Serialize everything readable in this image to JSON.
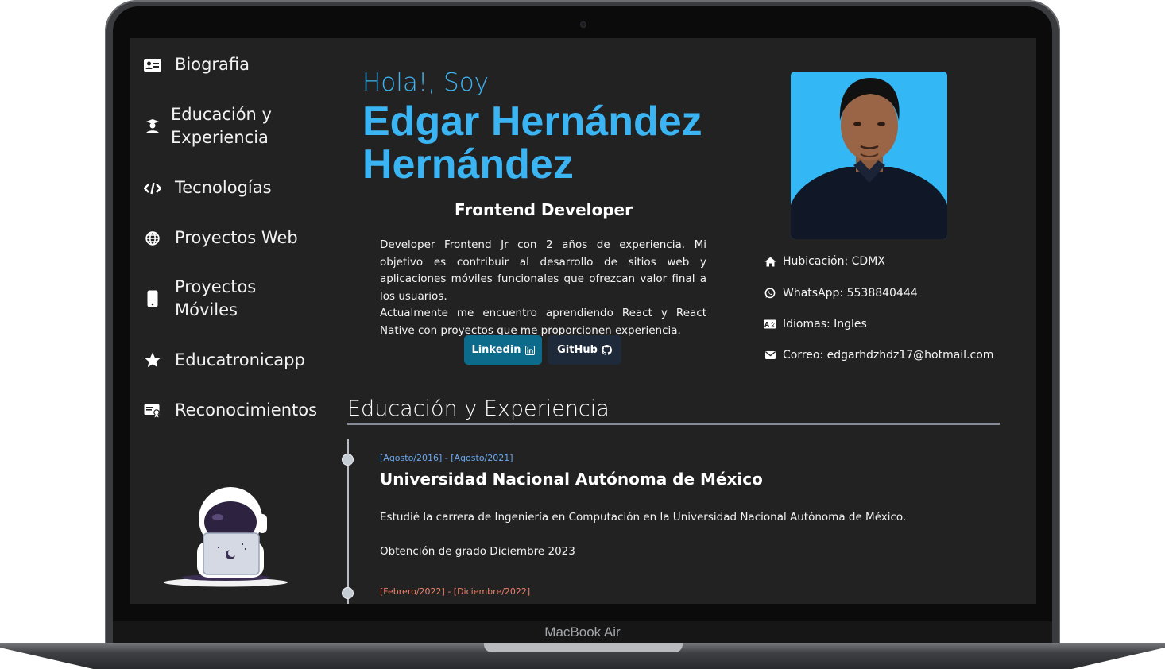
{
  "device": {
    "brand_label": "MacBook Air"
  },
  "sidebar": {
    "items": [
      {
        "label": "Biografia",
        "icon": "id-card-icon"
      },
      {
        "label": "Educación y Experiencia",
        "icon": "graduate-icon"
      },
      {
        "label": "Tecnologías",
        "icon": "code-icon"
      },
      {
        "label": "Proyectos Web",
        "icon": "globe-icon"
      },
      {
        "label": "Proyectos Móviles",
        "icon": "smartphone-icon"
      },
      {
        "label": "Educatronicapp",
        "icon": "star-icon"
      },
      {
        "label": "Reconocimientos",
        "icon": "certificate-icon"
      }
    ]
  },
  "hero": {
    "greeting": "Hola!, Soy",
    "name_line1": "Edgar Hernández",
    "name_line2": "Hernández",
    "role": "Frontend Developer",
    "bio_p1": "Developer Frontend Jr con 2 años de experiencia. Mi objetivo es contribuir al desarrollo de sitios web y aplicaciones móviles funcionales que ofrezcan valor final a los usuarios.",
    "bio_p2": "Actualmente me encuentro aprendiendo React y React Native con proyectos que me proporcionen experiencia.",
    "buttons": {
      "linkedin": "Linkedin",
      "github": "GitHub"
    }
  },
  "contact": {
    "location": "Hubicación: CDMX",
    "whatsapp": "WhatsApp: 5538840444",
    "languages": "Idiomas: Ingles",
    "email": "Correo: edgarhdzhdz17@hotmail.com"
  },
  "education": {
    "title": "Educación y Experiencia",
    "entries": [
      {
        "date": "[Agosto/2016] - [Agosto/2021]",
        "date_color": "#6aa8f0",
        "title": "Universidad Nacional Autónoma de México",
        "text1": "Estudié la carrera de Ingeniería en Computación en la Universidad Nacional Autónoma de México.",
        "text2": "Obtención de grado Diciembre 2023"
      },
      {
        "date": "[Febrero/2022] - [Diciembre/2022]",
        "date_color": "#f07f6a"
      }
    ]
  },
  "colors": {
    "accent": "#3ab4f2",
    "screen_bg": "#222223",
    "linkedin_btn": "#0c6a8b",
    "github_btn": "#1e2a3a",
    "photo_bg": "#33b8f5"
  }
}
